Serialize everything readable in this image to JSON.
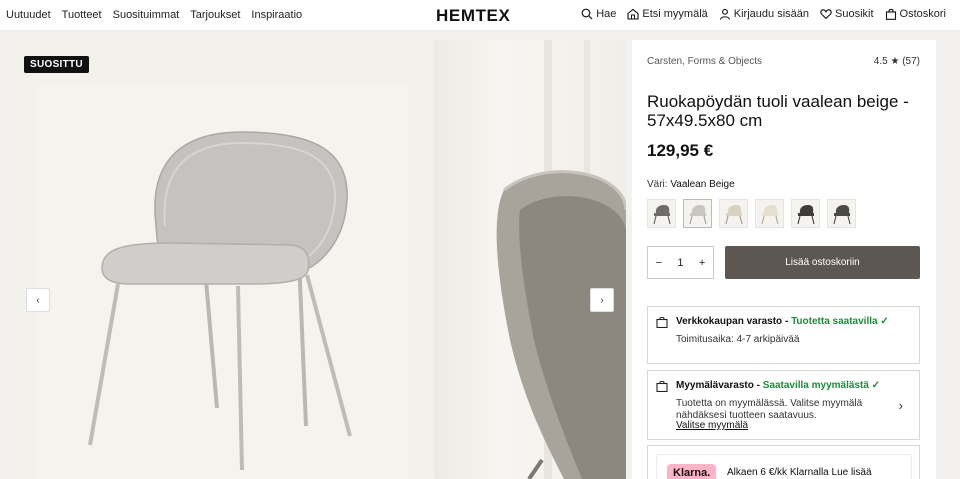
{
  "nav_left": [
    "Uutuudet",
    "Tuotteet",
    "Suosituimmat",
    "Tarjoukset",
    "Inspiraatio"
  ],
  "logo": "HEMTEX",
  "nav_right": {
    "search": "Hae",
    "store": "Etsi myymälä",
    "login": "Kirjaudu sisään",
    "favorites": "Suosikit",
    "cart": "Ostoskori"
  },
  "gallery": {
    "badge": "SUOSITTU",
    "prev": "‹",
    "next": "›"
  },
  "product": {
    "brand": "Carsten, Forms & Objects",
    "rating": "4.5 ★ (57)",
    "title": "Ruokapöydän tuoli vaalean beige - 57x49.5x80 cm",
    "price": "129,95 €",
    "color_label": "Väri:",
    "color_value": "Vaalean Beige",
    "swatch_colors": [
      "#6f6d6a",
      "#c9c6c0",
      "#d8d2c2",
      "#e6dfd2",
      "#3e3d3c",
      "#4a4a48"
    ],
    "qty_minus": "−",
    "qty_value": "1",
    "qty_plus": "+",
    "add_to_cart": "Lisää ostoskoriin"
  },
  "stock_online": {
    "label": "Verkkokaupan varasto - ",
    "status": "Tuotetta saatavilla ✓",
    "delivery": "Toimitusaika: 4-7 arkipäivää"
  },
  "stock_store": {
    "label": "Myymälävarasto - ",
    "status": "Saatavilla myymälästä ✓",
    "text": "Tuotetta on myymälässä. Valitse myymälä nähdäksesi tuotteen saatavuus.",
    "link": "Valitse myymälä",
    "chevron": "›"
  },
  "klarna": {
    "logo": "Klarna.",
    "text": "Alkaen 6 €/kk Klarnalla Lue lisää"
  },
  "colors": {
    "accent_button": "#5e5650",
    "available_green": "#1e8a3c",
    "klarna_pink": "#ffb3c7"
  }
}
